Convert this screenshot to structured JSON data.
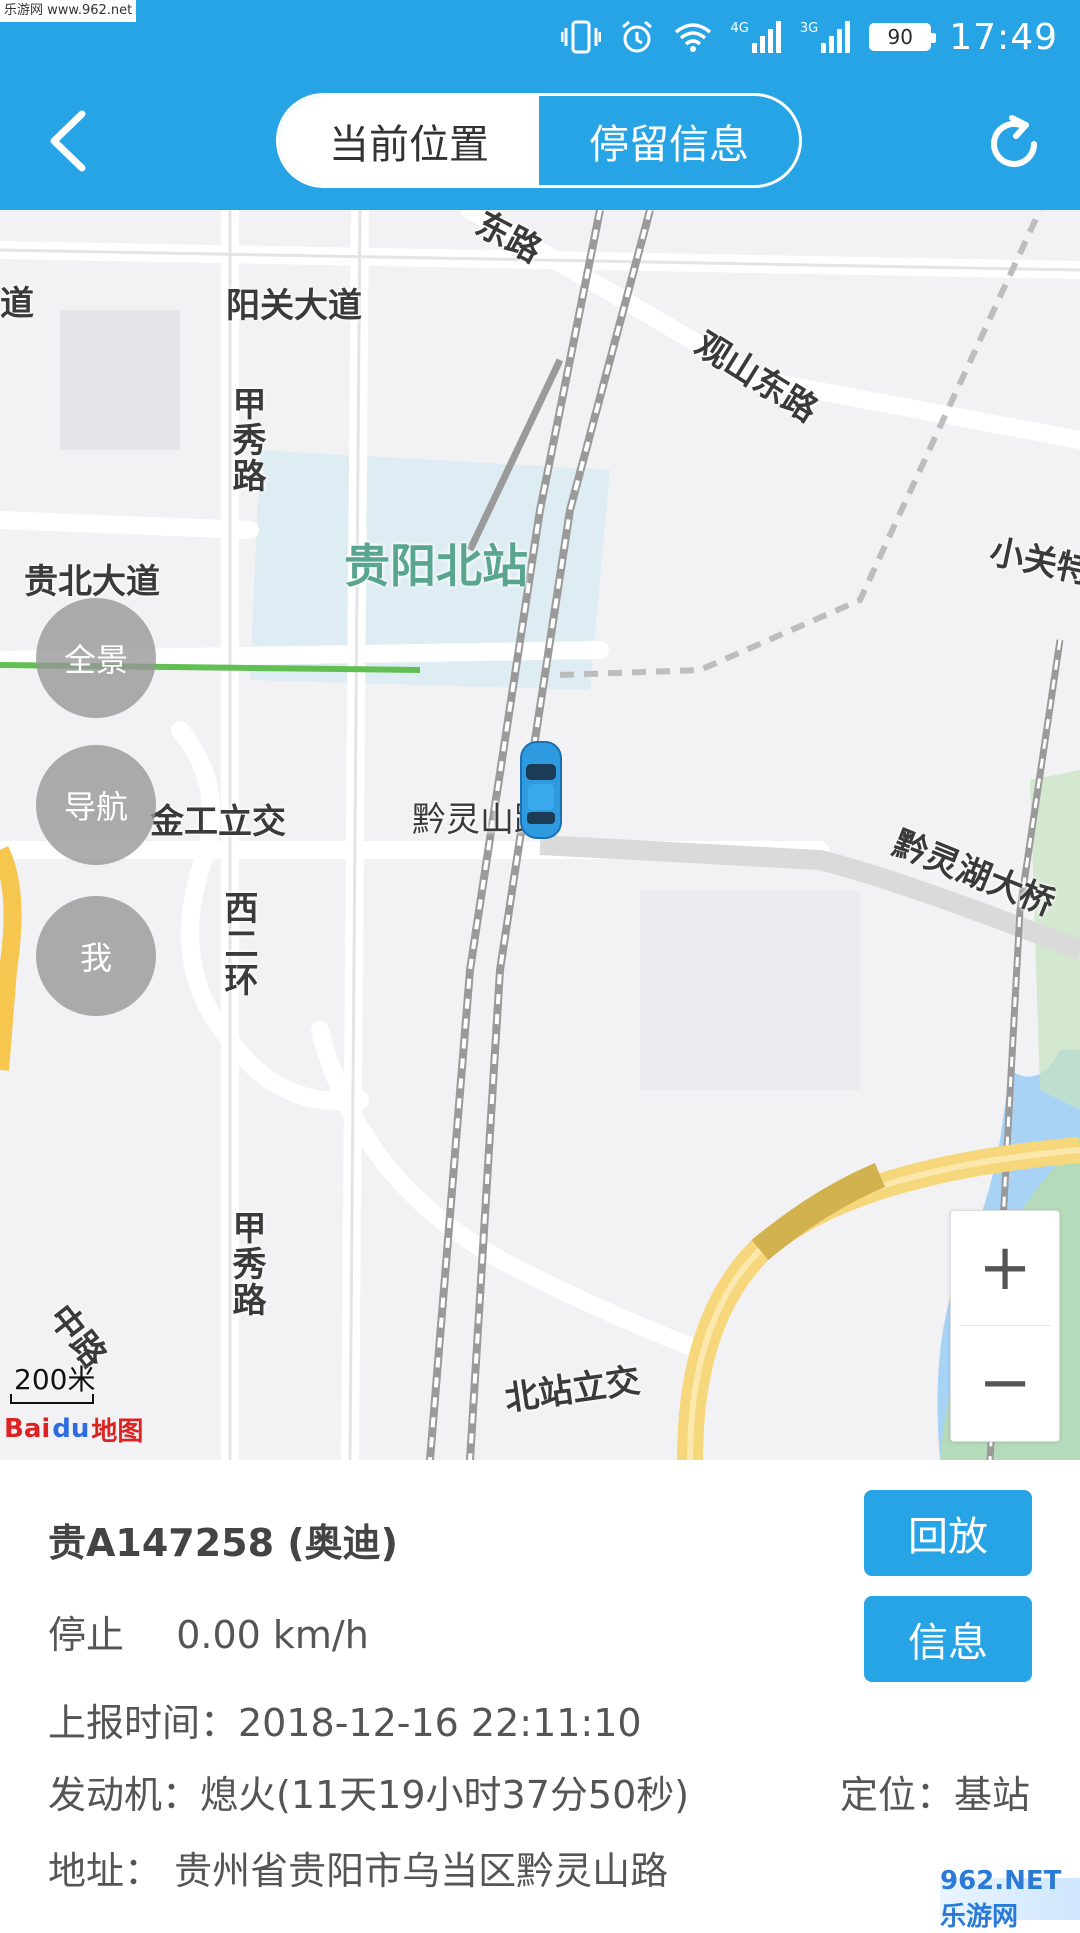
{
  "watermark": "乐游网 www.962.net",
  "status_bar": {
    "net1": "4G",
    "net2": "3G",
    "battery": "90",
    "time": "17:49"
  },
  "header": {
    "tabs": [
      {
        "label": "当前位置",
        "active": true
      },
      {
        "label": "停留信息",
        "active": false
      }
    ],
    "back_icon": "chevron-left-icon",
    "refresh_icon": "refresh-icon",
    "color": "#27a4e6"
  },
  "map": {
    "labels": {
      "dongLu": "东路",
      "dao": "道",
      "yangguan": "阳关大道",
      "guanshan": "观山东路",
      "jiaxiu1": "甲秀路",
      "guibei": "贵北大道",
      "station": "贵阳北站",
      "xiaoguan": "小关特",
      "jingong": "金工立交",
      "qianlingshan": "黔灵山路",
      "qianlinghu": "黔灵湖大桥",
      "xierhuan": "西二环",
      "jiaxiu2": "甲秀路",
      "beizhan": "北站立交",
      "zhonglu": "中路"
    },
    "side_buttons": {
      "panorama": "全景",
      "navigate": "导航",
      "me": "我"
    },
    "zoom": {
      "in": "+",
      "out": "−"
    },
    "scale": "200米",
    "logo": {
      "a": "Bai",
      "b": "du",
      "c": "地图"
    }
  },
  "vehicle": {
    "plate": "贵A147258 (奥迪)",
    "status": "停止",
    "speed": "0.00 km/h",
    "report_time": "上报时间：2018-12-16 22:11:10",
    "engine": "发动机：熄火(11天19小时37分50秒)",
    "positioning": "定位：基站",
    "address": "地址： 贵州省贵阳市乌当区黔灵山路"
  },
  "actions": {
    "playback": "回放",
    "info": "信息"
  },
  "corner_logo": "962.NET 乐游网"
}
